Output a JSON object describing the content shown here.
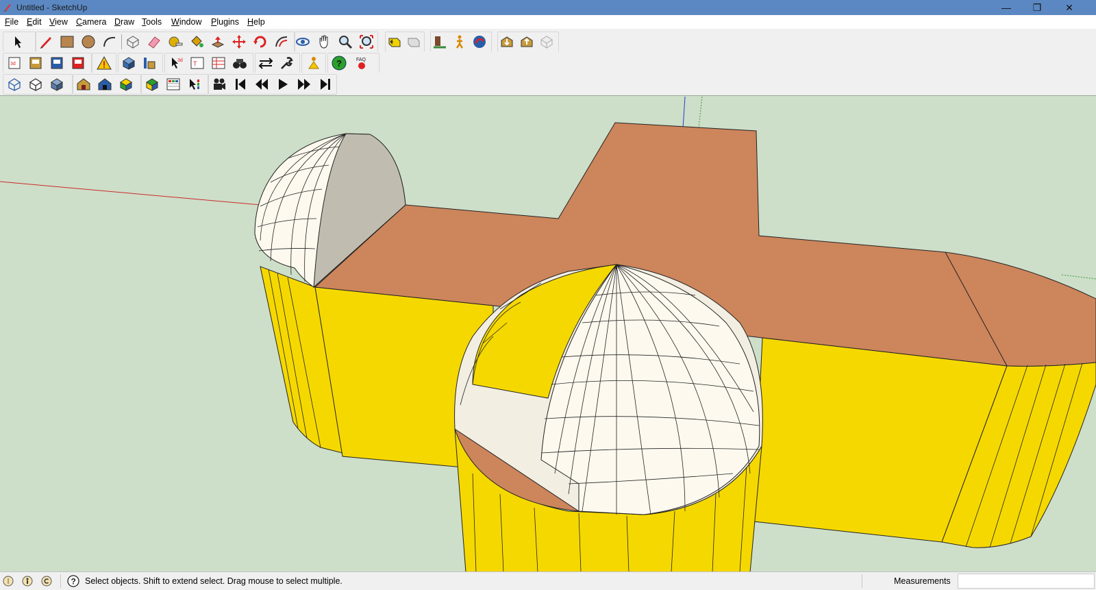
{
  "window": {
    "title": "Untitled - SketchUp",
    "controls": [
      "—",
      "❐",
      "✕"
    ]
  },
  "menu": [
    {
      "label": "File",
      "accel": "F",
      "rest": "ile"
    },
    {
      "label": "Edit",
      "accel": "E",
      "rest": "dit"
    },
    {
      "label": "View",
      "accel": "V",
      "rest": "iew"
    },
    {
      "label": "Camera",
      "accel": "C",
      "rest": "amera"
    },
    {
      "label": "Draw",
      "accel": "D",
      "rest": "raw"
    },
    {
      "label": "Tools",
      "accel": "T",
      "rest": "ools"
    },
    {
      "label": "Window",
      "accel": "W",
      "rest": "indow"
    },
    {
      "label": "Plugins",
      "accel": "P",
      "rest": "lugins"
    },
    {
      "label": "Help",
      "accel": "H",
      "rest": "elp"
    }
  ],
  "toolbars": {
    "row1": [
      "select-icon",
      "pencil-line-icon",
      "rectangle-icon",
      "circle-icon",
      "arc-icon",
      "make-component-icon",
      "eraser-icon",
      "tape-measure-icon",
      "paint-bucket-icon",
      "push-pull-icon",
      "move-icon",
      "rotate-icon",
      "offset-icon",
      "orbit-icon",
      "pan-icon",
      "zoom-icon",
      "zoom-extents-icon",
      "previous-view-icon",
      "next-view-icon",
      "position-camera-icon",
      "walk-icon",
      "look-around-icon",
      "get-models-icon",
      "share-model-icon",
      "share-component-icon"
    ],
    "row2": [
      "export-3d-icon",
      "export-obj-icon",
      "export-dxf-icon",
      "export-web-icon",
      "warning-icon",
      "model-info-icon",
      "layers-icon",
      "text-cursor-icon",
      "text-3d-icon",
      "table-icon",
      "binoculars-icon",
      "swap-arrows-icon",
      "wrench-icon",
      "figure-icon",
      "help-icon",
      "faq-icon"
    ],
    "row3": [
      "wireframe-icon",
      "hidden-line-icon",
      "shaded-box-icon",
      "house-shaded-icon",
      "house-texture-icon",
      "color-cube-icon",
      "materials-cube-icon",
      "grid-table-icon",
      "select-bars-icon",
      "movie-camera-icon",
      "first-frame-icon",
      "rewind-icon",
      "play-icon",
      "fast-forward-icon",
      "last-frame-icon"
    ]
  },
  "status": {
    "message": "Select objects. Shift to extend select. Drag mouse to select multiple.",
    "measurements_label": "Measurements",
    "measurements_value": ""
  },
  "colors": {
    "titlebar": "#5b88c2",
    "viewport_bg": "#cddec9",
    "face_yellow": "#f5d800",
    "face_brown": "#cd855b",
    "dome_white": "#fdf9ee",
    "back_face_gray": "#c0bdb0"
  }
}
